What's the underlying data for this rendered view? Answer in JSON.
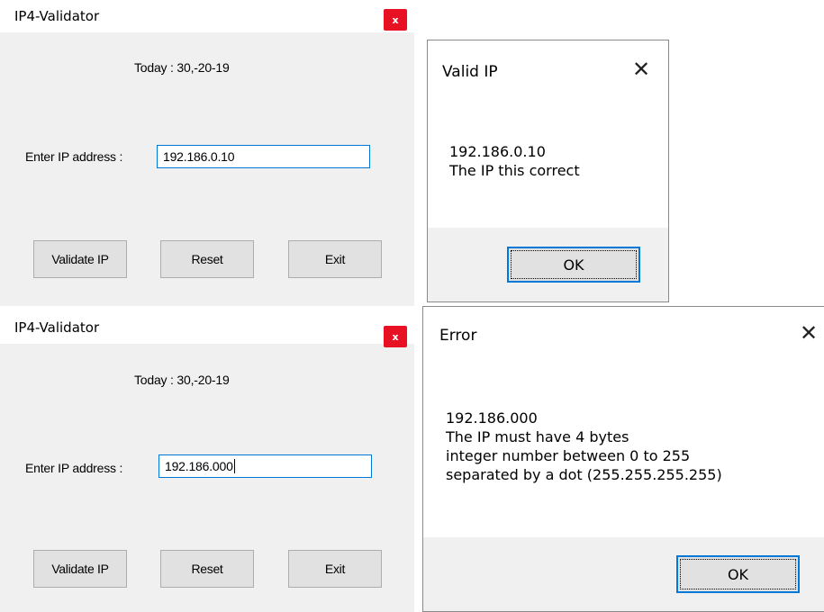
{
  "app": {
    "title": "IP4-Validator",
    "close_glyph": "x",
    "date_text": "Today : 30,-20-19",
    "ip_label": "Enter IP address :",
    "buttons": {
      "validate": "Validate IP",
      "reset": "Reset",
      "exit": "Exit"
    }
  },
  "instance_top": {
    "ip_value": "192.186.0.10"
  },
  "instance_bottom": {
    "ip_value": "192.186.000"
  },
  "dialog_valid": {
    "title": "Valid IP",
    "close_glyph": "✕",
    "message_lines": [
      "192.186.0.10",
      "The IP this correct"
    ],
    "ok_label": "OK"
  },
  "dialog_error": {
    "title": "Error",
    "close_glyph": "✕",
    "message_lines": [
      "192.186.000",
      "The IP must have 4 bytes",
      "integer number between 0 to 255",
      "separated by a dot (255.255.255.255)"
    ],
    "ok_label": "OK"
  },
  "colors": {
    "accent": "#0078d7",
    "close_red": "#e81123",
    "window_bg": "#f0f0f0"
  }
}
